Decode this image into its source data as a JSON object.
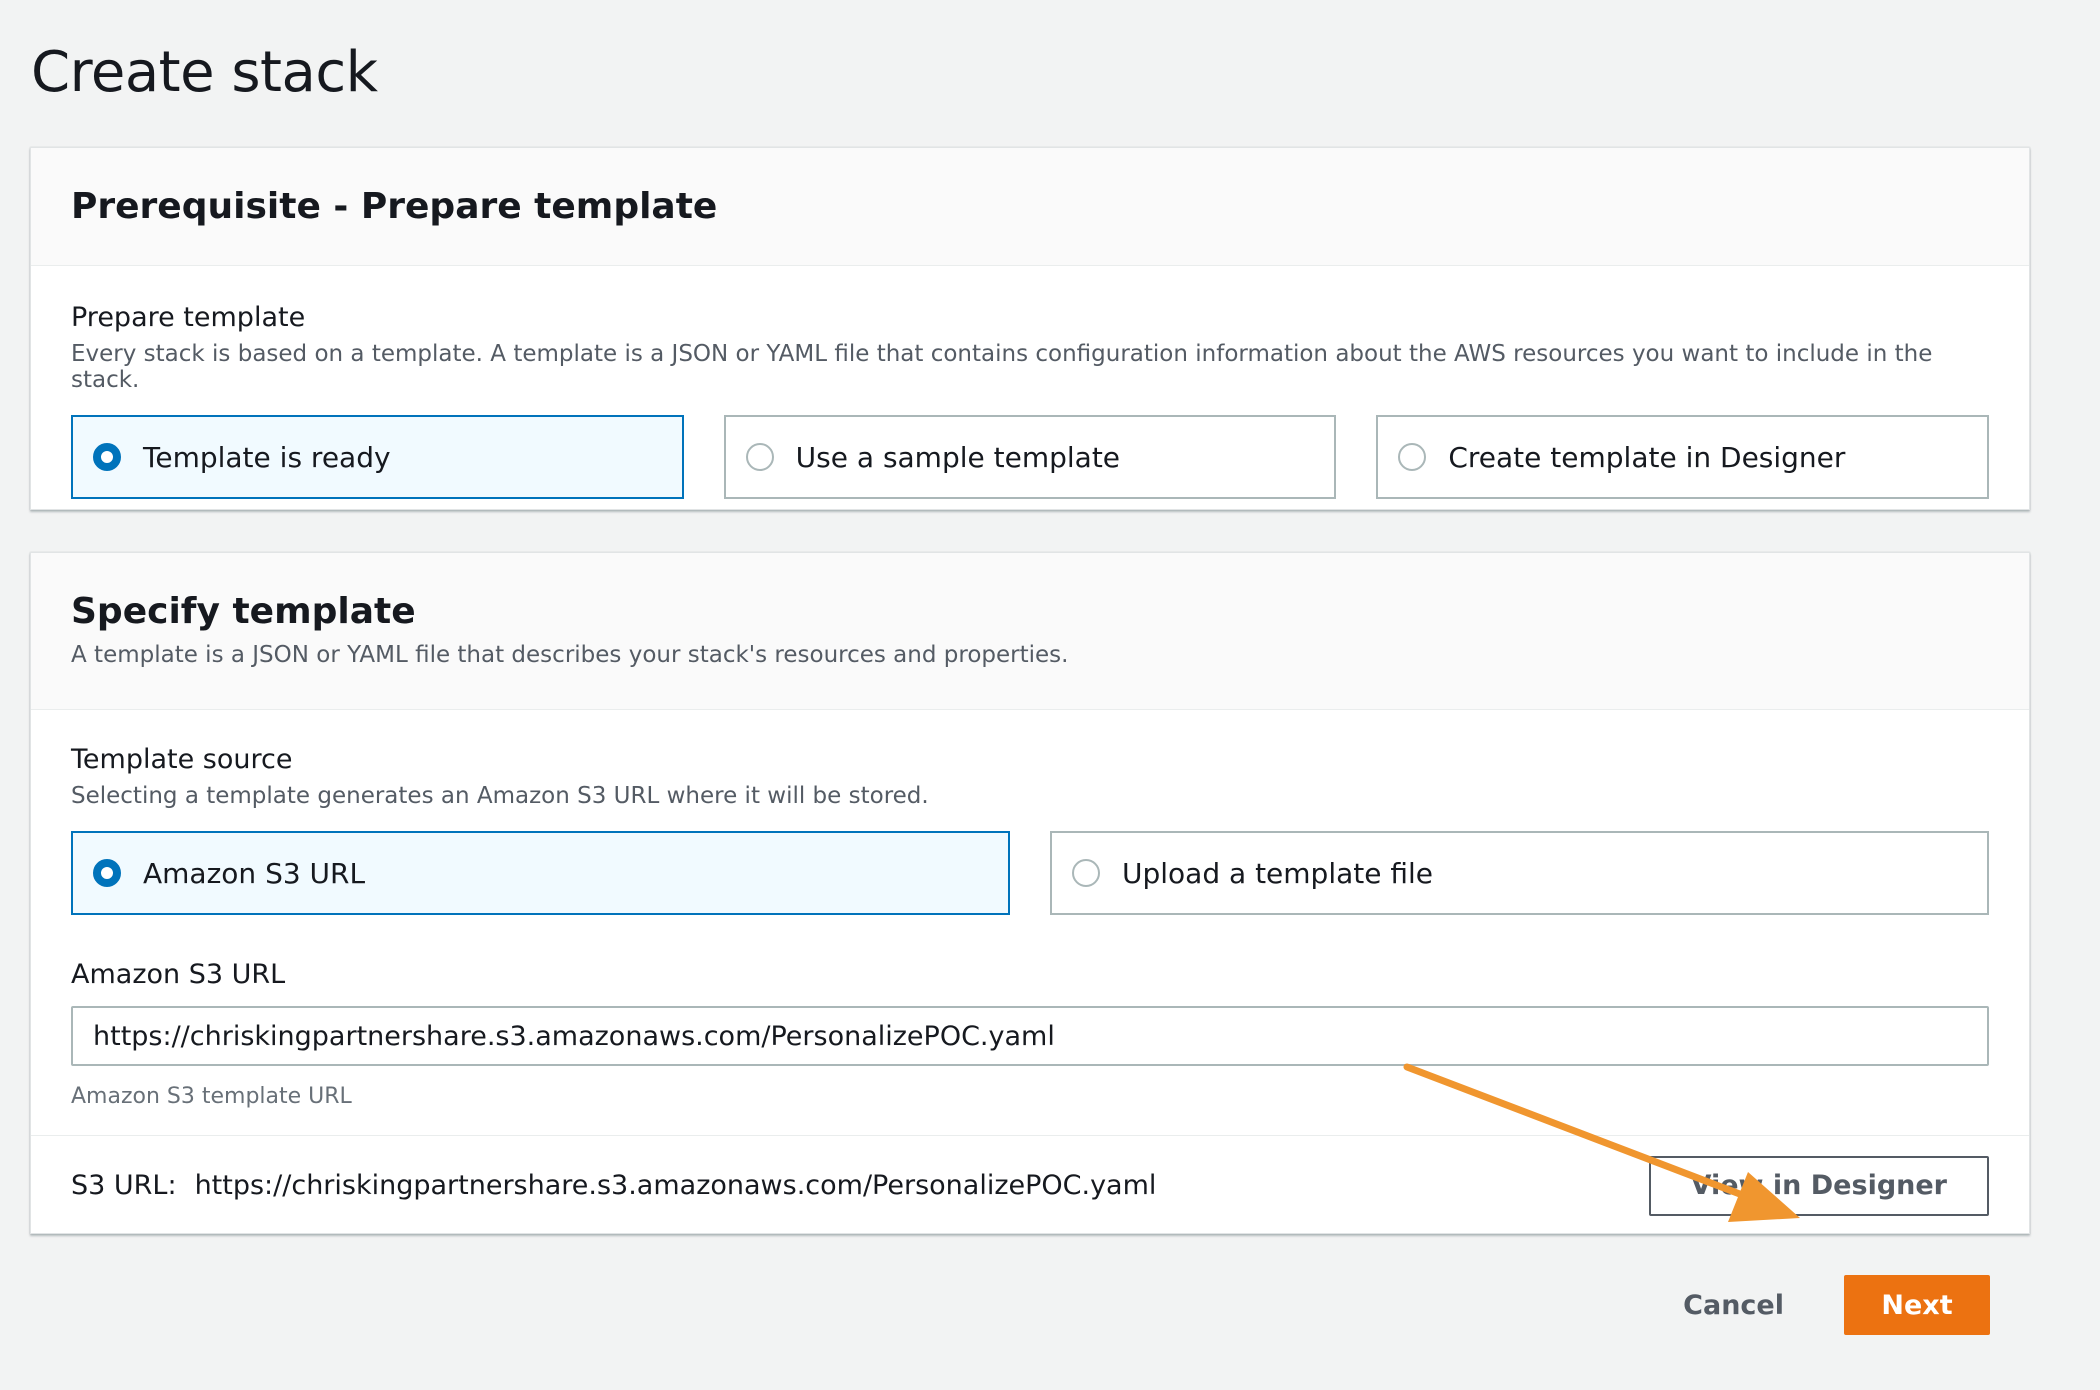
{
  "page": {
    "title": "Create stack"
  },
  "prerequisite": {
    "title": "Prerequisite - Prepare template",
    "field_label": "Prepare template",
    "field_desc": "Every stack is based on a template. A template is a JSON or YAML file that contains configuration information about the AWS resources you want to include in the stack.",
    "options": [
      {
        "label": "Template is ready",
        "selected": true
      },
      {
        "label": "Use a sample template",
        "selected": false
      },
      {
        "label": "Create template in Designer",
        "selected": false
      }
    ]
  },
  "specify": {
    "title": "Specify template",
    "desc": "A template is a JSON or YAML file that describes your stack's resources and properties.",
    "source_label": "Template source",
    "source_desc": "Selecting a template generates an Amazon S3 URL where it will be stored.",
    "source_options": [
      {
        "label": "Amazon S3 URL",
        "selected": true
      },
      {
        "label": "Upload a template file",
        "selected": false
      }
    ],
    "url_label": "Amazon S3 URL",
    "url_value": "https://chriskingpartnershare.s3.amazonaws.com/PersonalizePOC.yaml",
    "url_constraint": "Amazon S3 template URL",
    "s3_key": "S3 URL:",
    "s3_value": "https://chriskingpartnershare.s3.amazonaws.com/PersonalizePOC.yaml",
    "view_designer_label": "View in Designer"
  },
  "actions": {
    "cancel_label": "Cancel",
    "next_label": "Next"
  },
  "colors": {
    "accent": "#0073bb",
    "primary_button": "#ec7211",
    "annotation_arrow": "#f0962f"
  },
  "icons": {
    "radio_checked": "radio-checked-icon",
    "radio_unchecked": "radio-unchecked-icon",
    "annotation": "arrow-icon"
  }
}
